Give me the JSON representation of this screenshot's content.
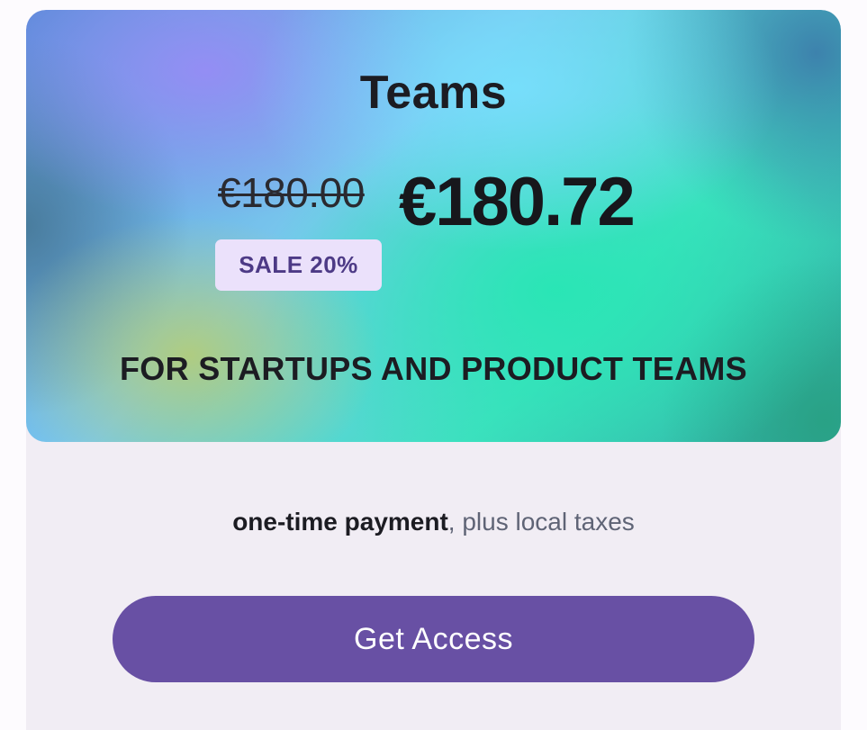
{
  "plan": {
    "name": "Teams",
    "original_price": "€180.00",
    "sale_price": "€180.72",
    "sale_badge": "SALE 20%",
    "audience": "FOR STARTUPS AND PRODUCT TEAMS"
  },
  "payment": {
    "strong": "one-time payment",
    "rest": ", plus local taxes"
  },
  "cta": {
    "label": "Get Access"
  },
  "colors": {
    "button": "#6850a4",
    "badge_background": "#ebe1fb",
    "badge_text": "#4d3a86",
    "card_background": "#f1edf4"
  }
}
